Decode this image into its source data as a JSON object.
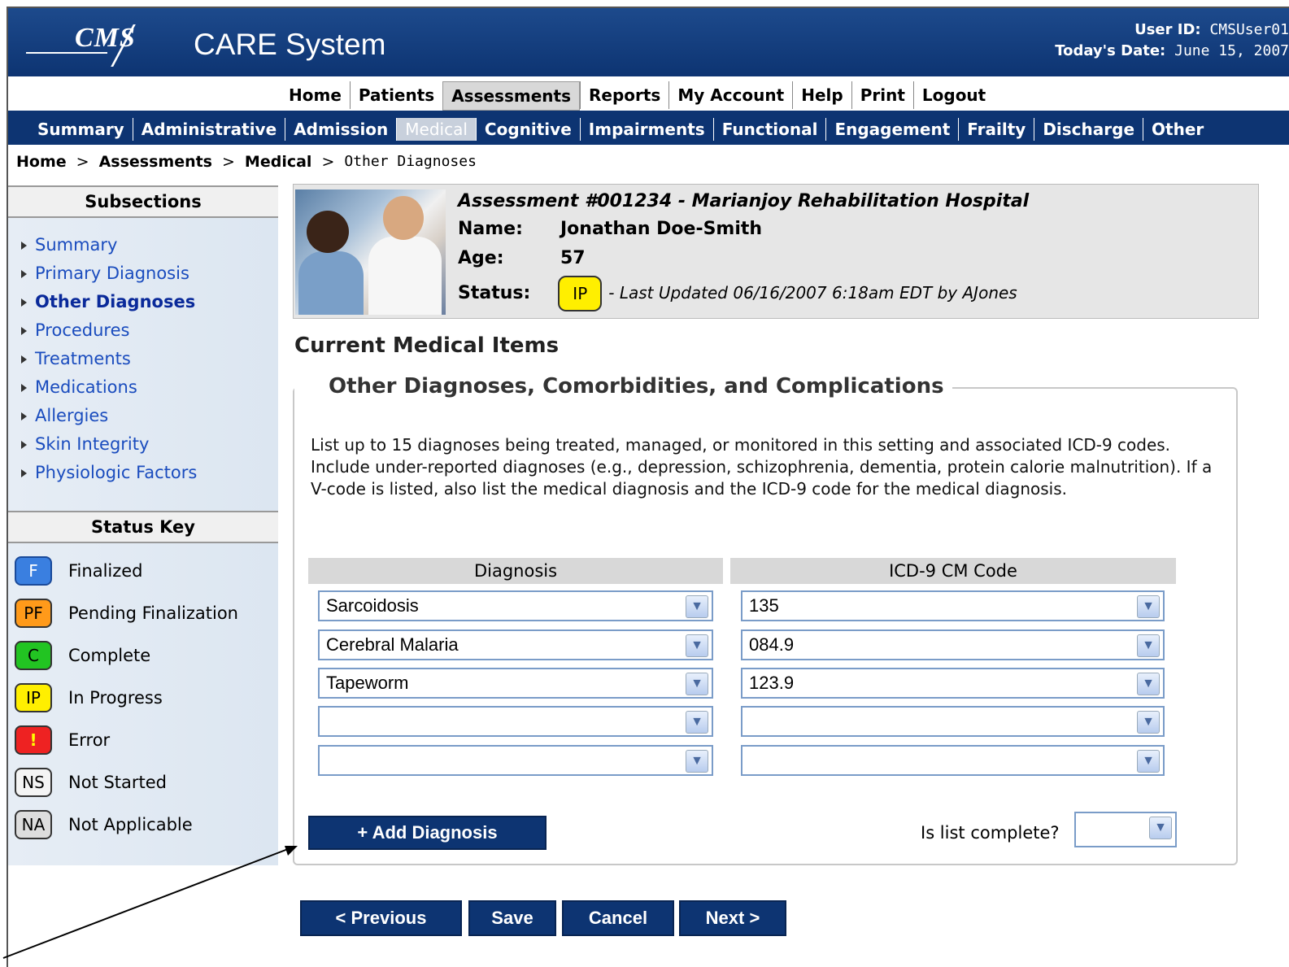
{
  "header": {
    "logo_text": "CMS",
    "app_title": "CARE System",
    "user_id_label": "User ID:",
    "user_id": "CMSUser01",
    "date_label": "Today's Date:",
    "date": "June 15, 2007"
  },
  "top_nav": [
    "Home",
    "Patients",
    "Assessments",
    "Reports",
    "My Account",
    "Help",
    "Print",
    "Logout"
  ],
  "top_nav_active": "Assessments",
  "sub_nav": [
    "Summary",
    "Administrative",
    "Admission",
    "Medical",
    "Cognitive",
    "Impairments",
    "Functional",
    "Engagement",
    "Frailty",
    "Discharge",
    "Other"
  ],
  "sub_nav_active": "Medical",
  "breadcrumb": {
    "items": [
      "Home",
      "Assessments",
      "Medical"
    ],
    "separator": ">",
    "current": "Other Diagnoses"
  },
  "sidebar": {
    "subsections_title": "Subsections",
    "items": [
      "Summary",
      "Primary Diagnosis",
      "Other Diagnoses",
      "Procedures",
      "Treatments",
      "Medications",
      "Allergies",
      "Skin Integrity",
      "Physiologic Factors"
    ],
    "active": "Other Diagnoses",
    "status_key_title": "Status Key",
    "status_key": [
      {
        "code": "F",
        "label": "Finalized",
        "color": "#3a7fe0",
        "text_color": "#ffffff"
      },
      {
        "code": "PF",
        "label": "Pending Finalization",
        "color": "#ff9a1a",
        "text_color": "#000000"
      },
      {
        "code": "C",
        "label": "Complete",
        "color": "#22c422",
        "text_color": "#000000"
      },
      {
        "code": "IP",
        "label": "In Progress",
        "color": "#ffef00",
        "text_color": "#000000"
      },
      {
        "code": "!",
        "label": "Error",
        "color": "#ee2222",
        "text_color": "#ffff00"
      },
      {
        "code": "NS",
        "label": "Not Started",
        "color": "#f4f4f4",
        "text_color": "#000000"
      },
      {
        "code": "NA",
        "label": "Not Applicable",
        "color": "#dddddd",
        "text_color": "#000000"
      }
    ]
  },
  "assessment": {
    "title": "Assessment #001234 - Marianjoy Rehabilitation Hospital",
    "name_label": "Name:",
    "name": "Jonathan Doe-Smith",
    "age_label": "Age:",
    "age": "57",
    "status_label": "Status:",
    "status_code": "IP",
    "last_updated": "- Last Updated 06/16/2007 6:18am EDT by AJones"
  },
  "main": {
    "section_title": "Current Medical Items",
    "group_title": "Other Diagnoses, Comorbidities, and Complications",
    "description": "List up to 15 diagnoses being treated, managed, or monitored in this setting and associated ICD-9 codes. Include under-reported diagnoses (e.g., depression, schizophrenia, dementia, protein calorie malnutrition). If a V-code is listed, also list the medical diagnosis and the ICD-9 code for the medical diagnosis.",
    "col_diagnosis": "Diagnosis",
    "col_code": "ICD-9 CM Code",
    "rows": [
      {
        "diagnosis": "Sarcoidosis",
        "code": "135"
      },
      {
        "diagnosis": "Cerebral Malaria",
        "code": "084.9"
      },
      {
        "diagnosis": "Tapeworm",
        "code": "123.9"
      },
      {
        "diagnosis": "",
        "code": ""
      },
      {
        "diagnosis": "",
        "code": ""
      }
    ],
    "add_button": "+ Add Diagnosis",
    "complete_label": "Is list complete?",
    "complete_value": ""
  },
  "footer_buttons": [
    "< Previous",
    "Save",
    "Cancel",
    "Next >"
  ]
}
